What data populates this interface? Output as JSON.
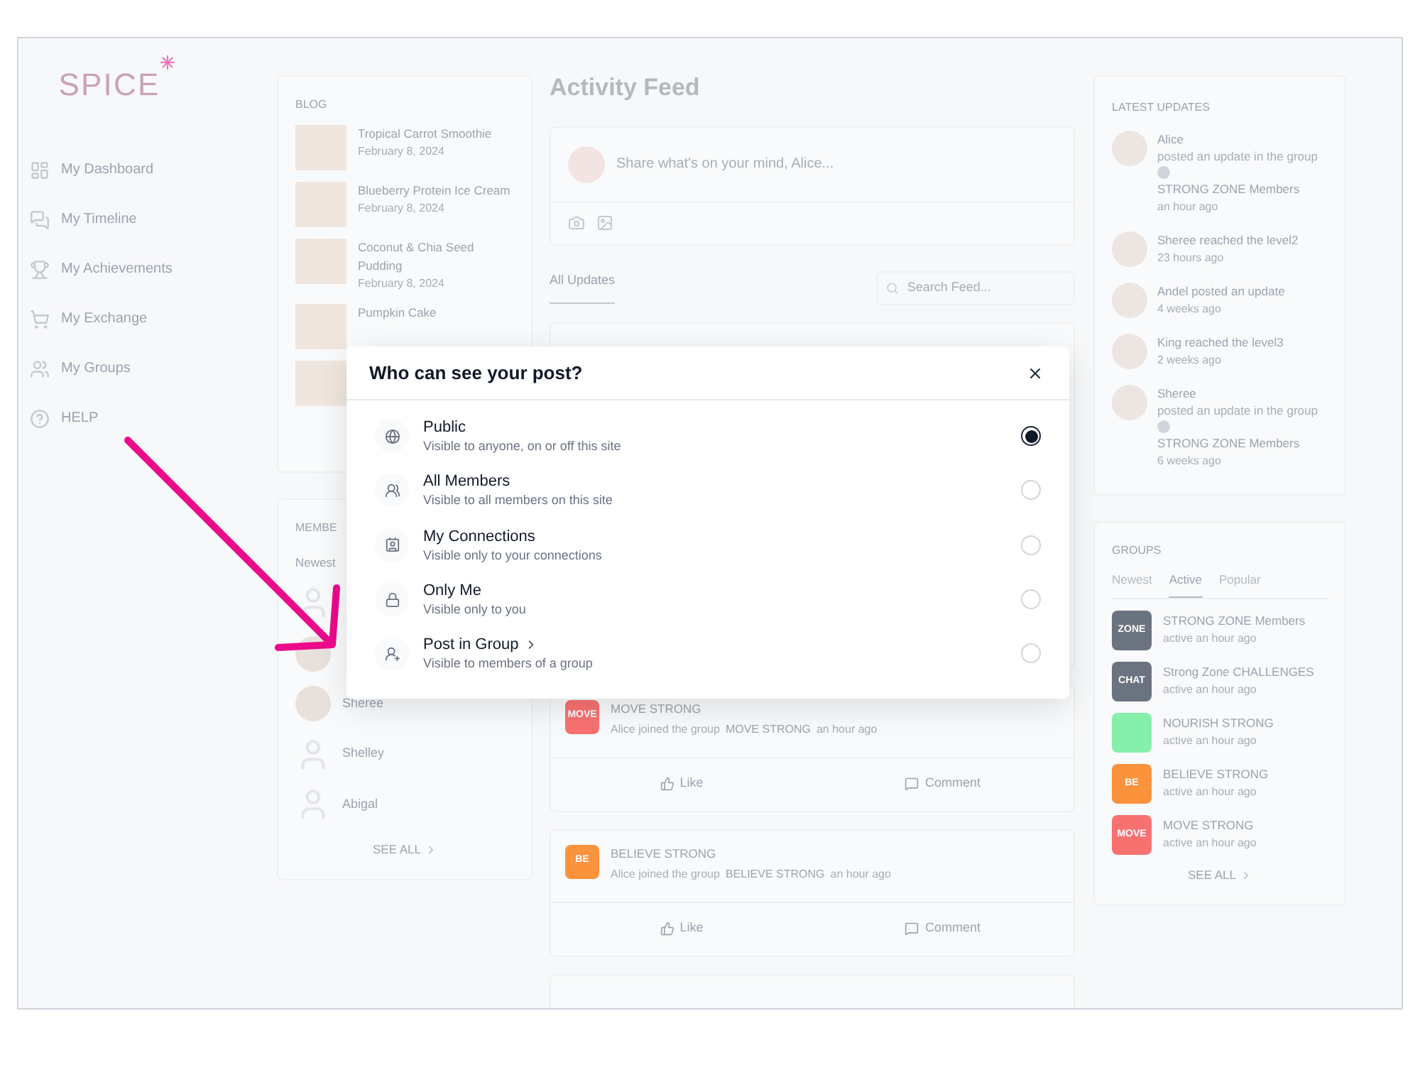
{
  "sidebar": {
    "logo": "SPICE",
    "items": [
      {
        "label": "My Dashboard"
      },
      {
        "label": "My Timeline"
      },
      {
        "label": "My Achievements"
      },
      {
        "label": "My Exchange"
      },
      {
        "label": "My Groups"
      },
      {
        "label": "HELP"
      }
    ]
  },
  "blog": {
    "title": "BLOG",
    "posts": [
      {
        "kind": "post",
        "title": "Tropical Carrot Smoothie",
        "date": "February 8, 2024"
      },
      {
        "kind": "post",
        "title": "Blueberry Protein Ice Cream",
        "date": "February 8, 2024"
      },
      {
        "kind": "post",
        "title": "Coconut & Chia Seed Pudding",
        "date": "February 8, 2024"
      },
      {
        "kind": "post",
        "title": "Pumpkin Cake"
      },
      {
        "kind": "image"
      }
    ]
  },
  "members": {
    "title": "MEMBE",
    "tab": "Newest",
    "list": [
      {
        "kind": "silhouette"
      },
      {
        "kind": "photo"
      },
      {
        "kind": "photo",
        "name": "Sheree"
      },
      {
        "kind": "silhouette",
        "name": "Shelley"
      },
      {
        "kind": "silhouette",
        "name": "Abigal"
      }
    ],
    "see_all": "SEE ALL"
  },
  "feed": {
    "title": "Activity Feed",
    "composer_placeholder": "Share what's on your mind, Alice...",
    "tabs": [
      {
        "label": "All Updates",
        "selected": true
      }
    ],
    "search_placeholder": "Search Feed...",
    "posts": [
      {
        "group": "MOVE STRONG",
        "logo": "MOVE",
        "color": "#f87171",
        "action": "Alice joined the group",
        "group_link": "MOVE STRONG",
        "time": "an hour ago",
        "like": "Like",
        "comment": "Comment"
      },
      {
        "group": "BELIEVE STRONG",
        "logo": "BE",
        "color": "#fb923c",
        "action": "Alice joined the group",
        "group_link": "BELIEVE STRONG",
        "time": "an hour ago",
        "like": "Like",
        "comment": "Comment"
      }
    ]
  },
  "latest_updates": {
    "title": "LATEST UPDATES",
    "items": [
      {
        "kind": "group",
        "name": "Alice",
        "text": "posted an update in the group",
        "group": "STRONG ZONE Members",
        "time": "an hour ago"
      },
      {
        "kind": "plain",
        "text": "Sheree reached the level2",
        "time": "23 hours ago"
      },
      {
        "kind": "plain",
        "text": "Andel posted an update",
        "time": "4 weeks ago"
      },
      {
        "kind": "plain",
        "text": "King reached the level3",
        "time": "2 weeks ago"
      },
      {
        "kind": "group",
        "name": "Sheree",
        "text": "posted an update in the group",
        "group": "STRONG ZONE Members",
        "time": "6 weeks ago"
      }
    ]
  },
  "groups": {
    "title": "GROUPS",
    "tabs": [
      {
        "label": "Newest",
        "selected": false
      },
      {
        "label": "Active",
        "selected": true
      },
      {
        "label": "Popular",
        "selected": false
      }
    ],
    "items": [
      {
        "name": "STRONG ZONE Members",
        "logo": "ZONE",
        "color": "#6b7280",
        "meta": "active an hour ago"
      },
      {
        "name": "Strong Zone CHALLENGES",
        "logo": "CHAT",
        "color": "#6b7280",
        "meta": "active an hour ago"
      },
      {
        "name": "NOURISH STRONG",
        "color": "#86efac",
        "meta": "active an hour ago"
      },
      {
        "name": "BELIEVE STRONG",
        "logo": "BE",
        "color": "#fb923c",
        "meta": "active an hour ago"
      },
      {
        "name": "MOVE STRONG",
        "logo": "MOVE",
        "color": "#f87171",
        "meta": "active an hour ago"
      }
    ],
    "see_all": "SEE ALL"
  },
  "dialog": {
    "title": "Who can see your post?",
    "options": [
      {
        "label": "Public",
        "description": "Visible to anyone, on or off this site",
        "selected": true,
        "submenu": false
      },
      {
        "label": "All Members",
        "description": "Visible to all members on this site",
        "selected": false,
        "submenu": false
      },
      {
        "label": "My Connections",
        "description": "Visible only to your connections",
        "selected": false,
        "submenu": false
      },
      {
        "label": "Only Me",
        "description": "Visible only to you",
        "selected": false,
        "submenu": false
      },
      {
        "label": "Post in Group",
        "description": "Visible to members of a group",
        "selected": false,
        "submenu": true
      }
    ]
  }
}
